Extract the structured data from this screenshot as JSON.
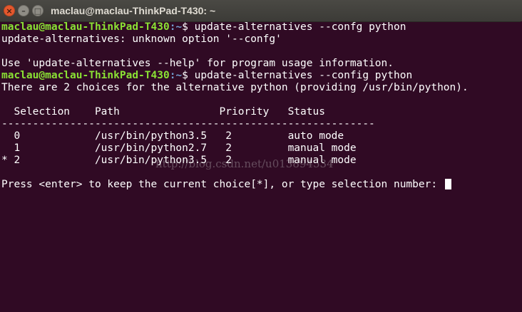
{
  "window": {
    "title": "maclau@maclau-ThinkPad-T430: ~",
    "buttons": {
      "close": "×",
      "minimize": "–",
      "maximize": "□"
    }
  },
  "terminal": {
    "prompt_user": "maclau@maclau-ThinkPad-T430",
    "prompt_path": ":~",
    "prompt_symbol": "$",
    "lines": [
      {
        "type": "prompt",
        "command": " update-alternatives --confg python"
      },
      {
        "type": "text",
        "text": "update-alternatives: unknown option '--confg'"
      },
      {
        "type": "text",
        "text": ""
      },
      {
        "type": "text",
        "text": "Use 'update-alternatives --help' for program usage information."
      },
      {
        "type": "prompt",
        "command": " update-alternatives --config python"
      },
      {
        "type": "text",
        "text": "There are 2 choices for the alternative python (providing /usr/bin/python)."
      },
      {
        "type": "text",
        "text": ""
      },
      {
        "type": "text",
        "text": "  Selection    Path                Priority   Status"
      },
      {
        "type": "text",
        "text": "------------------------------------------------------------"
      },
      {
        "type": "text",
        "text": "  0            /usr/bin/python3.5   2         auto mode"
      },
      {
        "type": "text",
        "text": "  1            /usr/bin/python2.7   2         manual mode"
      },
      {
        "type": "text",
        "text": "* 2            /usr/bin/python3.5   2         manual mode"
      },
      {
        "type": "text",
        "text": ""
      },
      {
        "type": "input",
        "text": "Press <enter> to keep the current choice[*], or type selection number: "
      }
    ]
  },
  "watermark": "http://blog.csdn.net/u013894534"
}
